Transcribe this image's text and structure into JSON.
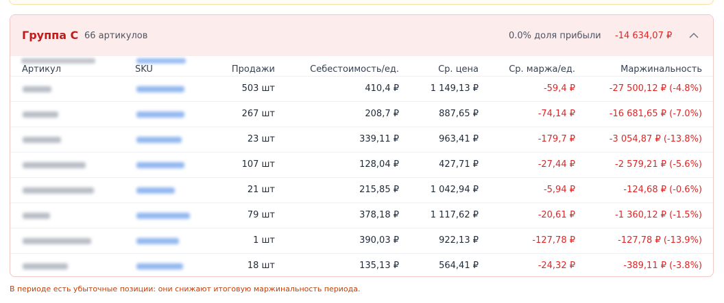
{
  "group": {
    "title": "Группа C",
    "count": "66 артикулов",
    "profit_share": "0.0% доля прибыли",
    "profit_value": "-14 634,07 ₽"
  },
  "columns": [
    "Артикул",
    "SKU",
    "Продажи",
    "Себестоимость/ед.",
    "Ср. цена",
    "Ср. маржа/ед.",
    "Маржинальность"
  ],
  "rows": [
    {
      "sales": "503 шт",
      "cost": "410,4 ₽",
      "price": "1 149,13 ₽",
      "margin_unit": "-59,4 ₽",
      "margin": "-27 500,12 ₽ (-4.8%)"
    },
    {
      "sales": "267 шт",
      "cost": "208,7 ₽",
      "price": "887,65 ₽",
      "margin_unit": "-74,14 ₽",
      "margin": "-16 681,65 ₽ (-7.0%)"
    },
    {
      "sales": "23 шт",
      "cost": "339,11 ₽",
      "price": "963,41 ₽",
      "margin_unit": "-179,7 ₽",
      "margin": "-3 054,87 ₽ (-13.8%)"
    },
    {
      "sales": "107 шт",
      "cost": "128,04 ₽",
      "price": "427,71 ₽",
      "margin_unit": "-27,44 ₽",
      "margin": "-2 579,21 ₽ (-5.6%)"
    },
    {
      "sales": "21 шт",
      "cost": "215,85 ₽",
      "price": "1 042,94 ₽",
      "margin_unit": "-5,94 ₽",
      "margin": "-124,68 ₽ (-0.6%)"
    },
    {
      "sales": "79 шт",
      "cost": "378,18 ₽",
      "price": "1 117,62 ₽",
      "margin_unit": "-20,61 ₽",
      "margin": "-1 360,12 ₽ (-1.5%)"
    },
    {
      "sales": "1 шт",
      "cost": "390,03 ₽",
      "price": "922,13 ₽",
      "margin_unit": "-127,78 ₽",
      "margin": "-127,78 ₽ (-13.9%)"
    },
    {
      "sales": "18 шт",
      "cost": "135,13 ₽",
      "price": "564,41 ₽",
      "margin_unit": "-24,32 ₽",
      "margin": "-389,11 ₽ (-3.8%)"
    }
  ],
  "footer_note": "В периоде есть убыточные позиции: они снижают итоговую маржинальность периода.",
  "colors": {
    "loss": "#dc2626",
    "title": "#c11a1a",
    "header_bg": "#fdecec",
    "border": "#f3c6c6",
    "note": "#c2410c"
  },
  "icons": {
    "collapse": "chevron-up-icon"
  }
}
